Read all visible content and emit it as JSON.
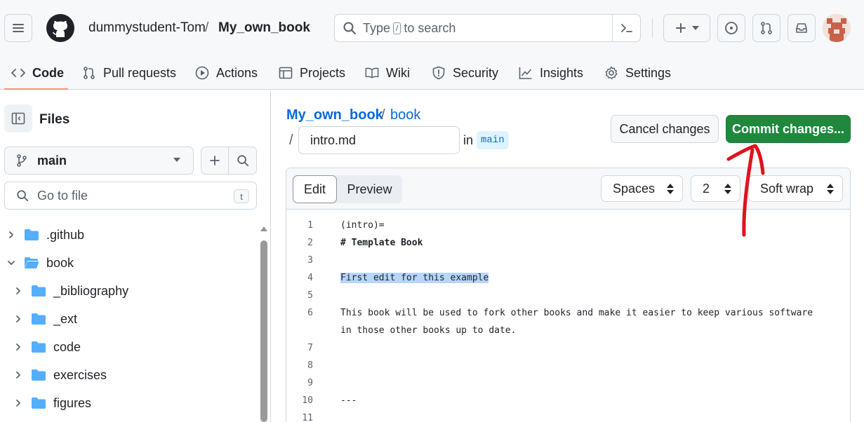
{
  "header": {
    "owner": "dummystudent-Tom",
    "separator": "/",
    "repo": "My_own_book",
    "search_prefix": "Type",
    "search_slash": "/",
    "search_suffix": "to search"
  },
  "tabs": [
    {
      "label": "Code",
      "icon": "code-icon"
    },
    {
      "label": "Pull requests",
      "icon": "pull-request-icon"
    },
    {
      "label": "Actions",
      "icon": "play-icon"
    },
    {
      "label": "Projects",
      "icon": "table-icon"
    },
    {
      "label": "Wiki",
      "icon": "book-icon"
    },
    {
      "label": "Security",
      "icon": "shield-icon"
    },
    {
      "label": "Insights",
      "icon": "graph-icon"
    },
    {
      "label": "Settings",
      "icon": "gear-icon"
    }
  ],
  "sidebar": {
    "title": "Files",
    "branch": "main",
    "goto_placeholder": "Go to file",
    "goto_shortcut": "t",
    "tree": [
      {
        "label": ".github",
        "expanded": false,
        "depth": 0
      },
      {
        "label": "book",
        "expanded": true,
        "depth": 0
      },
      {
        "label": "_bibliography",
        "expanded": false,
        "depth": 1
      },
      {
        "label": "_ext",
        "expanded": false,
        "depth": 1
      },
      {
        "label": "code",
        "expanded": false,
        "depth": 1
      },
      {
        "label": "exercises",
        "expanded": false,
        "depth": 1
      },
      {
        "label": "figures",
        "expanded": false,
        "depth": 1
      }
    ]
  },
  "main": {
    "path_repo": "My_own_book",
    "path_sep": "/",
    "path_dir": "book",
    "filename": "intro.md",
    "in_label": "in",
    "branch": "main",
    "cancel_label": "Cancel changes",
    "commit_label": "Commit changes..."
  },
  "editor": {
    "tab_edit": "Edit",
    "tab_preview": "Preview",
    "indent_mode": "Spaces",
    "indent_size": "2",
    "wrap_mode": "Soft wrap",
    "lines": [
      {
        "n": "1",
        "text": "(intro)="
      },
      {
        "n": "2",
        "text": "# Template Book"
      },
      {
        "n": "3",
        "text": ""
      },
      {
        "n": "4",
        "text": "First edit for this example"
      },
      {
        "n": "5",
        "text": ""
      },
      {
        "n": "6",
        "text": "This book will be used to fork other books and make it easier to keep various software"
      },
      {
        "n": "",
        "text": "in those other books up to date."
      },
      {
        "n": "7",
        "text": ""
      },
      {
        "n": "8",
        "text": ""
      },
      {
        "n": "9",
        "text": ""
      },
      {
        "n": "10",
        "text": "---"
      },
      {
        "n": "11",
        "text": ""
      }
    ]
  },
  "colors": {
    "accent_blue": "#0969da",
    "commit_green": "#1f883d",
    "annotation_red": "#e0121d",
    "tab_underline": "#fd8c73"
  }
}
